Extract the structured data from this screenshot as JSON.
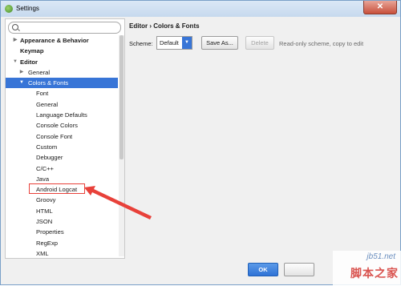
{
  "window": {
    "title": "Settings",
    "close_glyph": "✕"
  },
  "sidebar": {
    "search_placeholder": "",
    "items": [
      {
        "label": "Appearance & Behavior",
        "bold": true,
        "arrow": "▶",
        "level": 0
      },
      {
        "label": "Keymap",
        "bold": true,
        "arrow": "",
        "level": 0
      },
      {
        "label": "Editor",
        "bold": true,
        "arrow": "▼",
        "level": 0
      },
      {
        "label": "General",
        "bold": false,
        "arrow": "▶",
        "level": 1
      },
      {
        "label": "Colors & Fonts",
        "bold": false,
        "arrow": "▼",
        "level": 1,
        "selected": true
      },
      {
        "label": "Font",
        "level": 2
      },
      {
        "label": "General",
        "level": 2
      },
      {
        "label": "Language Defaults",
        "level": 2
      },
      {
        "label": "Console Colors",
        "level": 2
      },
      {
        "label": "Console Font",
        "level": 2
      },
      {
        "label": "Custom",
        "level": 2
      },
      {
        "label": "Debugger",
        "level": 2
      },
      {
        "label": "C/C++",
        "level": 2
      },
      {
        "label": "Java",
        "level": 2
      },
      {
        "label": "Android Logcat",
        "level": 2
      },
      {
        "label": "Groovy",
        "level": 2
      },
      {
        "label": "HTML",
        "level": 2
      },
      {
        "label": "JSON",
        "level": 2
      },
      {
        "label": "Properties",
        "level": 2
      },
      {
        "label": "RegExp",
        "level": 2
      },
      {
        "label": "XML",
        "level": 2
      }
    ]
  },
  "main": {
    "breadcrumb": "Editor › Colors & Fonts",
    "scheme_label": "Scheme:",
    "scheme_value": "Default",
    "save_as_label": "Save As...",
    "delete_label": "Delete",
    "readonly_note": "Read-only scheme, copy to edit"
  },
  "footer": {
    "ok_label": "OK"
  },
  "watermark": {
    "top": "jb51.net",
    "bottom": "脚本之家"
  },
  "colors": {
    "selection": "#3875d7",
    "annotation": "#e8413a"
  }
}
